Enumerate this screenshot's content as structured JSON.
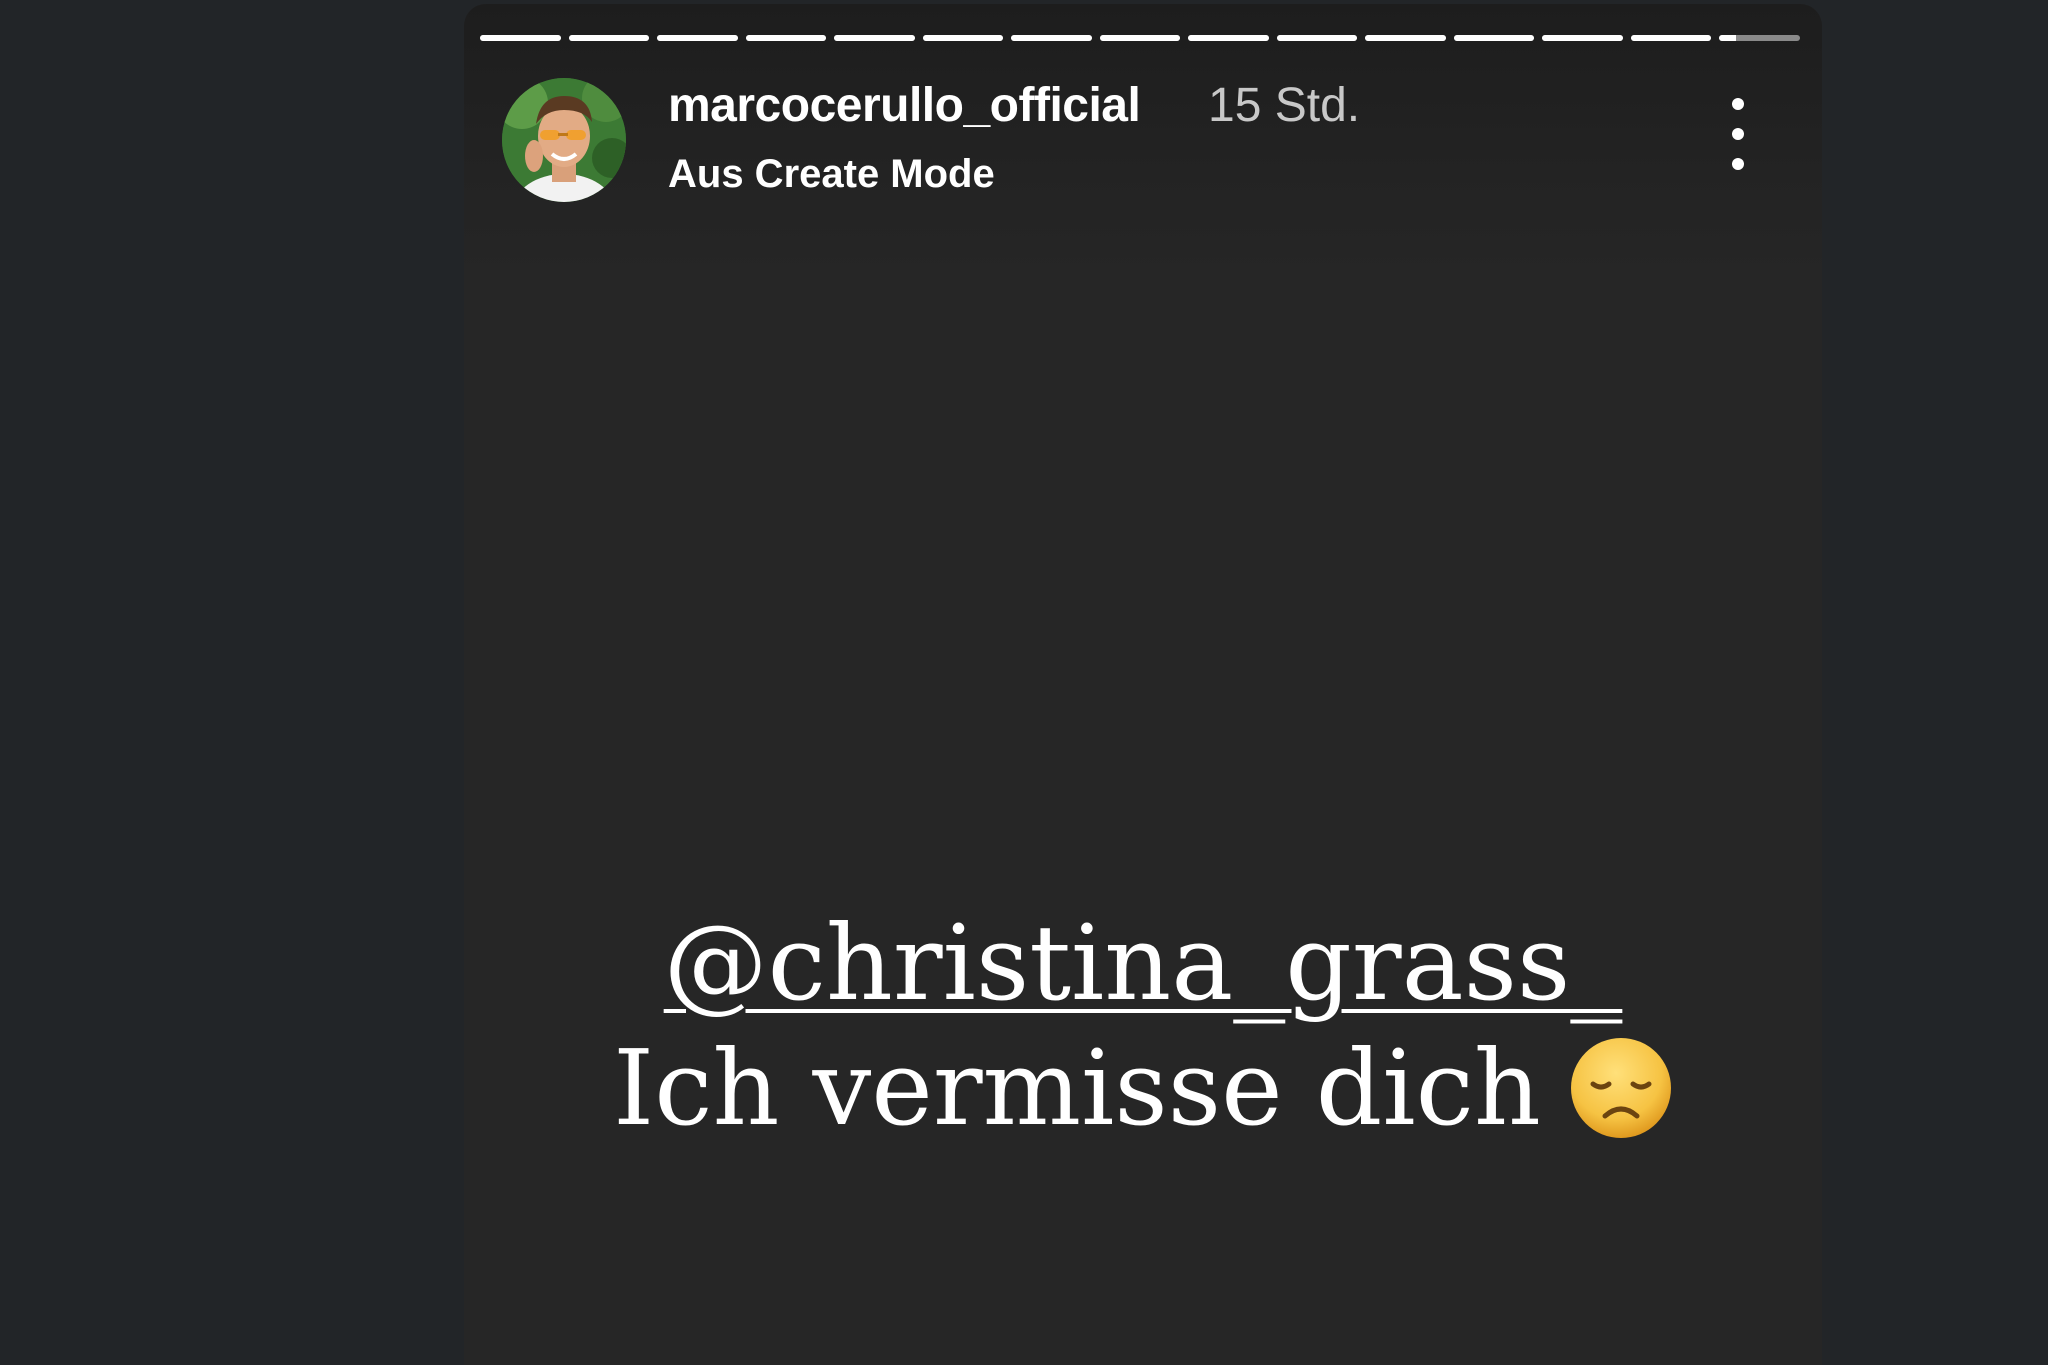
{
  "story": {
    "progress_segments": [
      1,
      1,
      1,
      1,
      1,
      1,
      1,
      1,
      1,
      1,
      1,
      1,
      1,
      1,
      0.2
    ],
    "username": "marcocerullo_official",
    "timestamp": "15 Std.",
    "subtitle": "Aus Create Mode",
    "avatar_icon": "profile-photo",
    "more_icon": "vertical-ellipsis-icon",
    "mention": "@christina_grass_",
    "message": "Ich vermisse dich",
    "emoji": "disappointed-face"
  },
  "colors": {
    "page_background": "#222528",
    "story_background": "#262626",
    "text": "#ffffff",
    "progress_done": "#ffffff",
    "progress_pending": "#8a8a8a",
    "emoji_face": "#f6c343"
  }
}
